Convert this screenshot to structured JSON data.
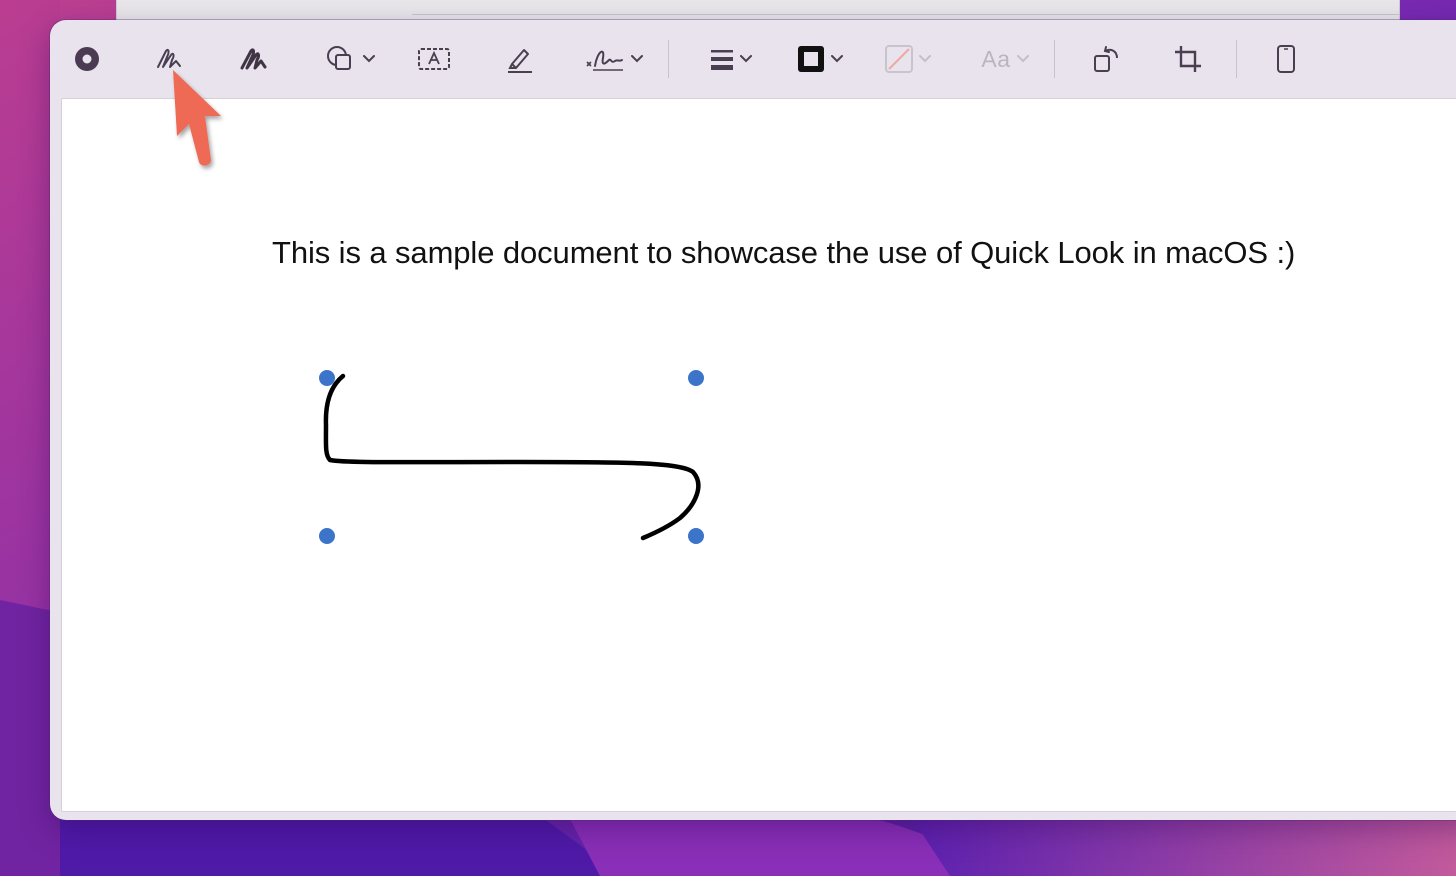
{
  "document": {
    "text": "This is a sample document to showcase the use of Quick Look in macOS :)"
  },
  "toolbar": {
    "font_label": "Aa",
    "buttons": [
      {
        "name": "record-icon"
      },
      {
        "name": "sketch-icon"
      },
      {
        "name": "draw-icon"
      },
      {
        "name": "shapes-icon"
      },
      {
        "name": "text-box-icon"
      },
      {
        "name": "highlight-icon"
      },
      {
        "name": "signature-icon"
      },
      {
        "name": "line-style-icon"
      },
      {
        "name": "border-color-icon"
      },
      {
        "name": "fill-color-icon"
      },
      {
        "name": "text-style-icon"
      },
      {
        "name": "rotate-icon"
      },
      {
        "name": "crop-icon"
      },
      {
        "name": "device-icon"
      }
    ]
  },
  "colors": {
    "selection_handle": "#3b74c8",
    "callout_arrow": "#ee6a55",
    "stroke": "#000000"
  }
}
